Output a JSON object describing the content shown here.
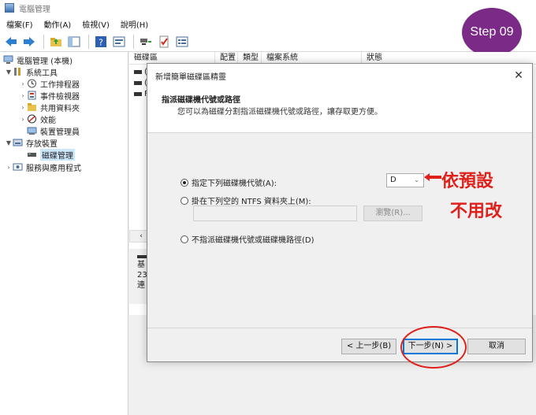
{
  "window": {
    "title": "電腦管理"
  },
  "menu": [
    "檔案(F)",
    "動作(A)",
    "檢視(V)",
    "說明(H)"
  ],
  "step_badge": "Step 09",
  "tree": {
    "root": "電腦管理 (本機)",
    "system_tools": "系統工具",
    "task_scheduler": "工作排程器",
    "event_viewer": "事件檢視器",
    "shared_folders": "共用資料夾",
    "performance": "效能",
    "device_manager": "裝置管理員",
    "storage": "存放裝置",
    "disk_management": "磁碟管理",
    "services_apps": "服務與應用程式"
  },
  "columns": [
    "磁碟區",
    "配置",
    "類型",
    "檔案系統",
    "狀態"
  ],
  "volume_rows": [
    "(",
    "(",
    "F"
  ],
  "disk_panel": {
    "line1": "基",
    "line2": "23",
    "line3": "連"
  },
  "dialog": {
    "title": "新增簡單磁碟區精靈",
    "header_title": "指派磁碟機代號或路徑",
    "header_sub": "您可以為磁碟分割指派磁碟機代號或路徑，讓存取更方便。",
    "opt_assign": "指定下列磁碟機代號(A):",
    "drive_value": "D",
    "opt_mount": "掛在下列空的 NTFS 資料夾上(M):",
    "path_value": "",
    "browse": "瀏覽(R)...",
    "opt_none": "不指派磁碟機代號或磁碟機路徑(D)",
    "back": "< 上一步(B)",
    "next": "下一步(N) >",
    "cancel": "取消"
  },
  "annotation": {
    "arrow": "⟵",
    "line1": "依預設",
    "line2": "不用改"
  },
  "colors": {
    "accent": "#0078d7",
    "annotation": "#e0211b",
    "badge": "#7c2a87"
  }
}
